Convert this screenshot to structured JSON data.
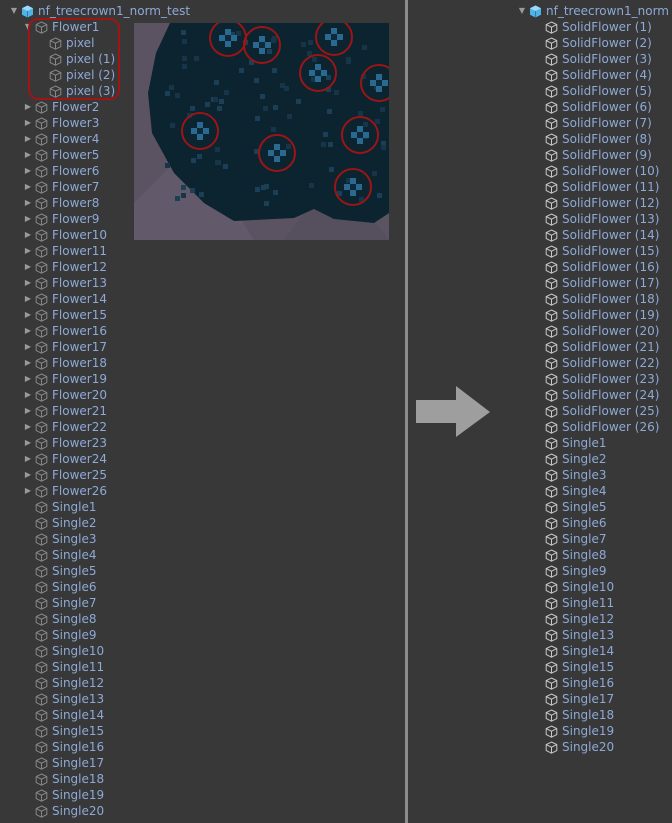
{
  "left": {
    "root_name": "nf_treecrown1_norm_test",
    "flower1": {
      "name": "Flower1",
      "pixels": [
        "pixel",
        "pixel (1)",
        "pixel (2)",
        "pixel (3)"
      ]
    },
    "flowers": [
      "Flower2",
      "Flower3",
      "Flower4",
      "Flower5",
      "Flower6",
      "Flower7",
      "Flower8",
      "Flower9",
      "Flower10",
      "Flower11",
      "Flower12",
      "Flower13",
      "Flower14",
      "Flower15",
      "Flower16",
      "Flower17",
      "Flower18",
      "Flower19",
      "Flower20",
      "Flower21",
      "Flower22",
      "Flower23",
      "Flower24",
      "Flower25",
      "Flower26"
    ],
    "singles": [
      "Single1",
      "Single2",
      "Single3",
      "Single4",
      "Single5",
      "Single6",
      "Single7",
      "Single8",
      "Single9",
      "Single10",
      "Single11",
      "Single12",
      "Single13",
      "Single14",
      "Single15",
      "Single16",
      "Single17",
      "Single18",
      "Single19",
      "Single20"
    ]
  },
  "right": {
    "root_name": "nf_treecrown1_norm",
    "solid_flowers": [
      "SolidFlower (1)",
      "SolidFlower (2)",
      "SolidFlower (3)",
      "SolidFlower (4)",
      "SolidFlower (5)",
      "SolidFlower (6)",
      "SolidFlower (7)",
      "SolidFlower (8)",
      "SolidFlower (9)",
      "SolidFlower (10)",
      "SolidFlower (11)",
      "SolidFlower (12)",
      "SolidFlower (13)",
      "SolidFlower (14)",
      "SolidFlower (15)",
      "SolidFlower (16)",
      "SolidFlower (17)",
      "SolidFlower (18)",
      "SolidFlower (19)",
      "SolidFlower (20)",
      "SolidFlower (21)",
      "SolidFlower (22)",
      "SolidFlower (23)",
      "SolidFlower (24)",
      "SolidFlower (25)",
      "SolidFlower (26)"
    ],
    "singles": [
      "Single1",
      "Single2",
      "Single3",
      "Single4",
      "Single5",
      "Single6",
      "Single7",
      "Single8",
      "Single9",
      "Single10",
      "Single11",
      "Single12",
      "Single13",
      "Single14",
      "Single15",
      "Single16",
      "Single17",
      "Single18",
      "Single19",
      "Single20"
    ]
  },
  "icons": {
    "prefab": "prefab-cube-icon",
    "gameobject": "gameobject-cube-icon",
    "foldout": "foldout-arrow-icon"
  },
  "colors": {
    "background": "#383838",
    "label": "#8ea9d6",
    "highlight": "#a01414",
    "divider": "#8c8c8c",
    "pixel_dark": "#0c2330",
    "pixel_light": "#1e4a66"
  }
}
